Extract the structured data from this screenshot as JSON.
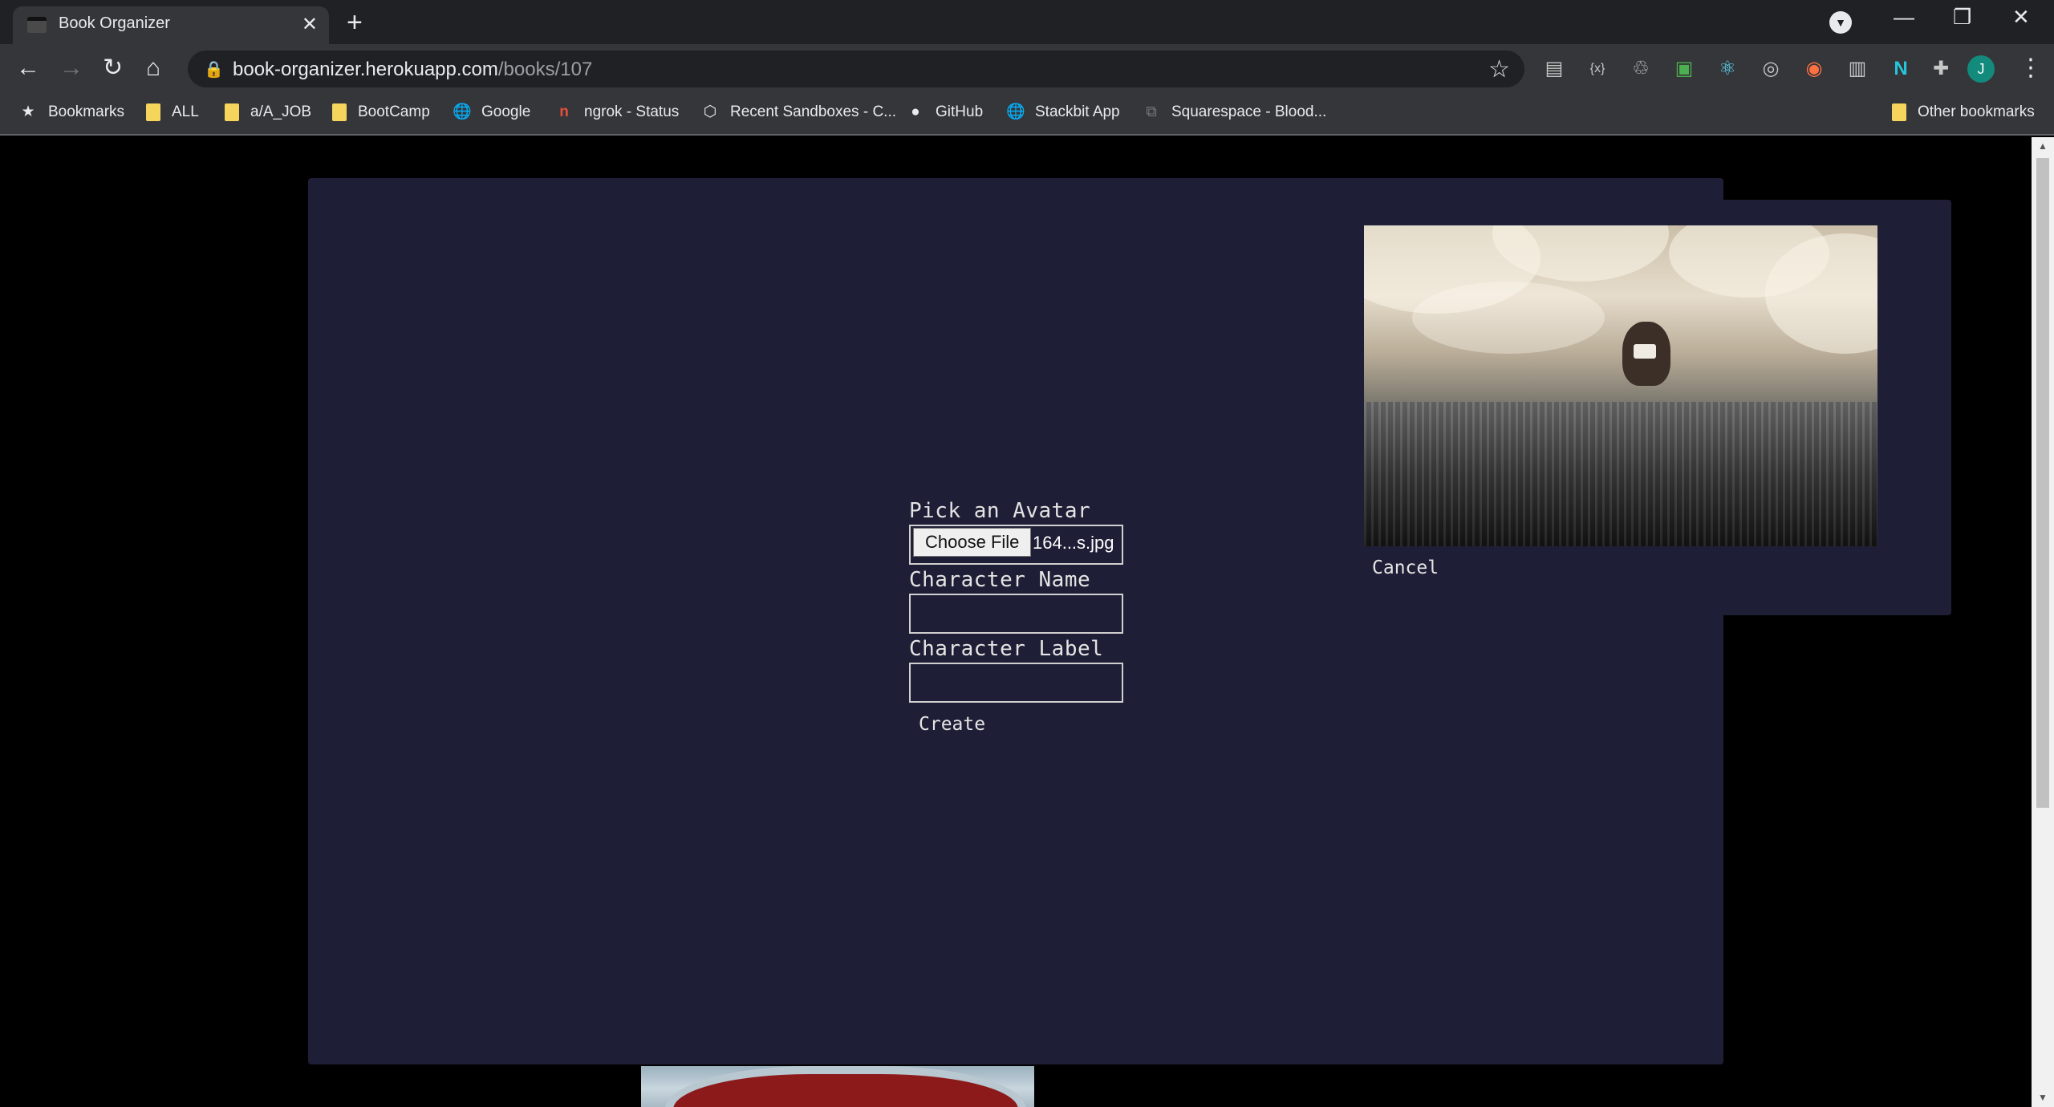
{
  "browser": {
    "tab_title": "Book Organizer",
    "url_host": "book-organizer.herokuapp.com",
    "url_path": "/books/107",
    "profile_initial": "J"
  },
  "bookmarks": [
    {
      "label": "Bookmarks",
      "icon": "star-icon"
    },
    {
      "label": "ALL",
      "icon": "folder-icon"
    },
    {
      "label": "a/A_JOB",
      "icon": "folder-icon"
    },
    {
      "label": "BootCamp",
      "icon": "folder-icon"
    },
    {
      "label": "Google",
      "icon": "globe-icon"
    },
    {
      "label": "ngrok - Status",
      "icon": "ngrok-icon"
    },
    {
      "label": "Recent Sandboxes - C...",
      "icon": "codesandbox-icon"
    },
    {
      "label": "GitHub",
      "icon": "github-icon"
    },
    {
      "label": "Stackbit App",
      "icon": "globe-icon"
    },
    {
      "label": "Squarespace - Blood...",
      "icon": "squarespace-icon"
    }
  ],
  "other_bookmarks": "Other bookmarks",
  "form": {
    "avatar_label": "Pick an Avatar",
    "choose_file": "Choose File",
    "file_name": "164...s.jpg",
    "name_label": "Character Name",
    "name_value": "",
    "label_label": "Character Label",
    "label_value": "",
    "create": "Create"
  },
  "preview": {
    "cancel": "Cancel"
  },
  "colors": {
    "modal_bg": "#1e1f36",
    "page_bg": "#000000",
    "chrome_dark": "#202124",
    "chrome_toolbar": "#35363a"
  }
}
